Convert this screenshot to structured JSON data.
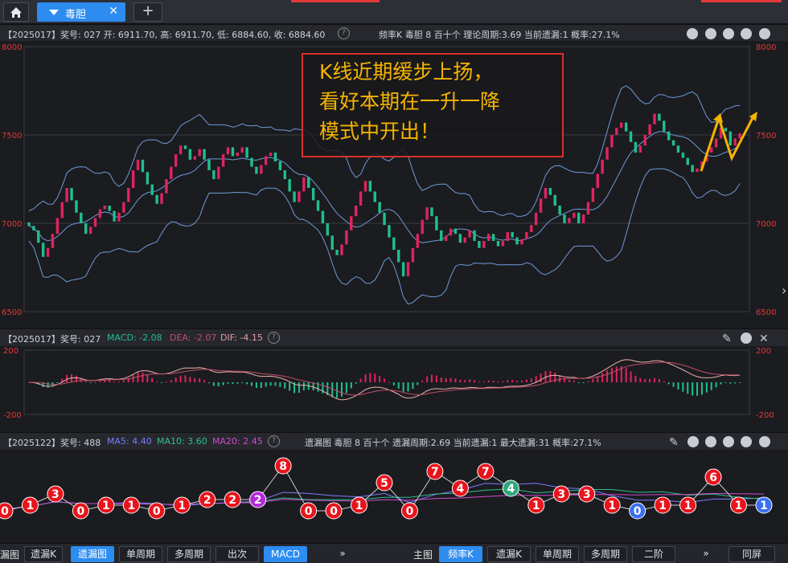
{
  "tabs": {
    "active_label": "毒胆",
    "close": "✕",
    "add": "+"
  },
  "price_header": {
    "text": "【2025017】奖号: 027  开: 6911.70, 高: 6911.70, 低: 6884.60, 收: 6884.60",
    "right": "频率K  毒胆  8  百十个  理论周期:3.69  当前遗漏:1  概率:27.1%"
  },
  "macd_header": {
    "prefix": "【2025017】奖号: 027",
    "macd": "MACD: -2.08",
    "dea": "DEA: -2.07",
    "dif": "DIF: -4.15"
  },
  "miss_header": {
    "prefix": "【2025122】奖号: 488",
    "ma5": "MA5: 4.40",
    "ma10": "MA10: 3.60",
    "ma20": "MA20: 2.45",
    "right": "遗漏图  毒胆  8  百十个  遗漏周期:2.69  当前遗漏:1  最大遗漏:31  概率:27.1%"
  },
  "annotation": {
    "line1": "K线近期缓步上扬，",
    "line2": "看好本期在一升一降",
    "line3": "模式中开出！"
  },
  "colors": {
    "up": "#e0245e",
    "down": "#1fbf8f",
    "band": "#6f9bd8",
    "axis": "#e03a3a",
    "accent": "#2d8cf0",
    "arrow": "#f5b400",
    "ma5": "#7a7dff",
    "ma10": "#2fbf8c",
    "ma20": "#d04ad0"
  },
  "bottom_left": {
    "items": [
      "遗漏K",
      "遗漏图",
      "单周期",
      "多周期",
      "出次",
      "MACD",
      "»"
    ],
    "active": 1,
    "active2": 5,
    "left_stub": "漏图"
  },
  "bottom_right": {
    "label": "主图",
    "items": [
      "频率K",
      "遗漏K",
      "单周期",
      "多周期",
      "二阶",
      "»",
      "同屏"
    ],
    "active": 0
  },
  "chart_data": [
    {
      "type": "candlestick",
      "ylim": [
        6500,
        8000
      ],
      "yticks": [
        6500,
        7000,
        7500,
        8000
      ],
      "close_series": [
        6985,
        6960,
        6890,
        6810,
        6860,
        6940,
        7030,
        7120,
        7200,
        7130,
        7060,
        7000,
        6940,
        6980,
        7030,
        7080,
        7100,
        7070,
        7010,
        7060,
        7120,
        7200,
        7300,
        7360,
        7290,
        7220,
        7160,
        7110,
        7170,
        7250,
        7320,
        7390,
        7440,
        7420,
        7360,
        7380,
        7420,
        7360,
        7300,
        7250,
        7320,
        7390,
        7430,
        7380,
        7400,
        7430,
        7370,
        7320,
        7280,
        7330,
        7380,
        7400,
        7350,
        7300,
        7250,
        7180,
        7120,
        7180,
        7260,
        7200,
        7130,
        7070,
        7000,
        6930,
        6850,
        6820,
        6880,
        6960,
        7040,
        7100,
        7180,
        7240,
        7180,
        7120,
        7060,
        6990,
        6920,
        6850,
        6780,
        6700,
        6780,
        6860,
        6940,
        7020,
        7090,
        7040,
        6960,
        6900,
        6930,
        6970,
        6940,
        6890,
        6920,
        6960,
        6900,
        6860,
        6900,
        6940,
        6900,
        6870,
        6900,
        6950,
        6920,
        6880,
        6910,
        6950,
        6990,
        7060,
        7140,
        7200,
        7160,
        7100,
        7050,
        7000,
        7030,
        7060,
        7000,
        7050,
        7120,
        7200,
        7280,
        7360,
        7430,
        7500,
        7540,
        7570,
        7520,
        7460,
        7400,
        7440,
        7500,
        7560,
        7620,
        7580,
        7520,
        7470,
        7440,
        7400,
        7370,
        7330,
        7290,
        7310,
        7350,
        7400,
        7430,
        7480,
        7540,
        7520,
        7440,
        7480,
        7510
      ]
    },
    {
      "type": "macd",
      "ylim": [
        -200,
        200
      ],
      "yticks": [
        -200,
        200
      ]
    },
    {
      "type": "line",
      "title": "遗漏图",
      "values": [
        0,
        1,
        3,
        0,
        1,
        1,
        0,
        1,
        2,
        2,
        2,
        8,
        0,
        0,
        1,
        5,
        0,
        7,
        4,
        7,
        4,
        1,
        3,
        3,
        1,
        0,
        1,
        1,
        6,
        1,
        1
      ],
      "series": [
        {
          "name": "MA5"
        },
        {
          "name": "MA10"
        },
        {
          "name": "MA20"
        }
      ]
    }
  ]
}
